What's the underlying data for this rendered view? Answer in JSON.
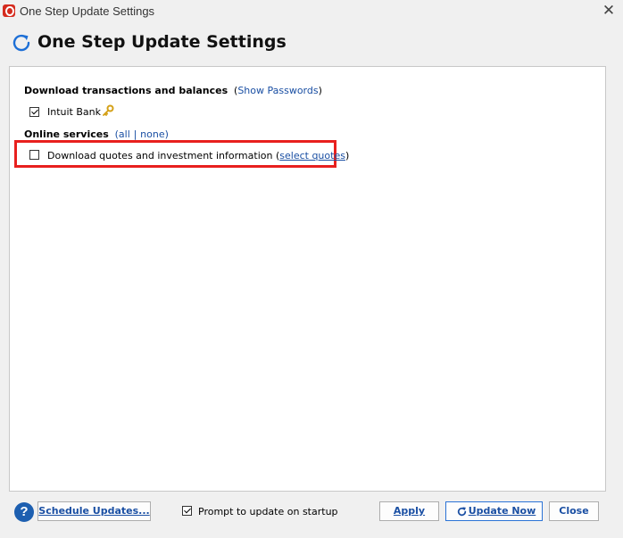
{
  "window": {
    "title": "One Step Update Settings",
    "close_glyph": "✕"
  },
  "header": {
    "title": "One Step Update Settings",
    "icon": "refresh-icon"
  },
  "download_section": {
    "label": "Download transactions and balances",
    "open_paren": "(",
    "link": "Show Passwords",
    "close_paren": ")",
    "accounts": [
      {
        "label": "Intuit Bank",
        "checked": true,
        "icon": "key-icon"
      }
    ]
  },
  "online_services": {
    "label": "Online services",
    "open_paren": "(",
    "all_link": "all",
    "separator": "|",
    "none_link": "none",
    "close_paren": ")",
    "items": [
      {
        "label": "Download quotes and investment information",
        "checked": false,
        "open_paren": "(",
        "link": "select quotes",
        "close_paren": ")"
      }
    ]
  },
  "footer": {
    "help_glyph": "?",
    "schedule_button": "Schedule Updates...",
    "prompt_label": "Prompt to update on startup",
    "prompt_checked": true,
    "apply_button": "Apply",
    "update_now_button": "Update Now",
    "close_button": "Close"
  },
  "colors": {
    "highlight": "#e8201e",
    "link": "#1a4fa3",
    "brand": "#d52b1e"
  }
}
